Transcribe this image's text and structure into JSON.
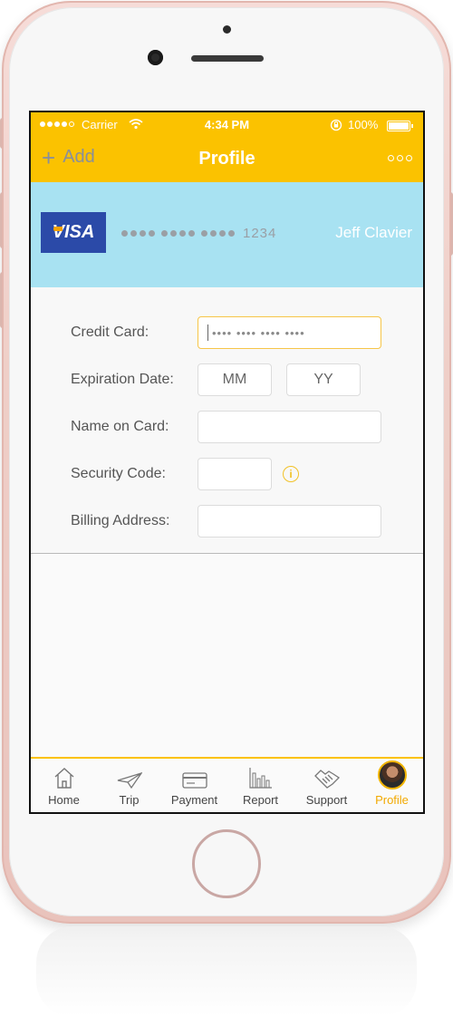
{
  "status_bar": {
    "carrier": "Carrier",
    "time": "4:34 PM",
    "battery": "100%"
  },
  "nav": {
    "add_label": "Add",
    "title": "Profile"
  },
  "card": {
    "brand": "VISA",
    "last4": "1234",
    "holder": "Jeff Clavier"
  },
  "form": {
    "credit_card_label": "Credit Card:",
    "credit_card_placeholder": "•••• •••• •••• ••••",
    "expiration_label": "Expiration Date:",
    "month_placeholder": "MM",
    "year_placeholder": "YY",
    "name_label": "Name on Card:",
    "security_label": "Security Code:",
    "billing_label": "Billing Address:"
  },
  "tabs": [
    {
      "label": "Home",
      "icon": "home-icon"
    },
    {
      "label": "Trip",
      "icon": "paper-plane-icon"
    },
    {
      "label": "Payment",
      "icon": "credit-card-icon"
    },
    {
      "label": "Report",
      "icon": "bar-chart-icon"
    },
    {
      "label": "Support",
      "icon": "handshake-icon"
    },
    {
      "label": "Profile",
      "icon": "avatar"
    }
  ],
  "colors": {
    "header": "#fbc200",
    "card_strip": "#a8e2f2",
    "active_tab": "#f2a900",
    "phone_shell": "#efcfc8"
  }
}
